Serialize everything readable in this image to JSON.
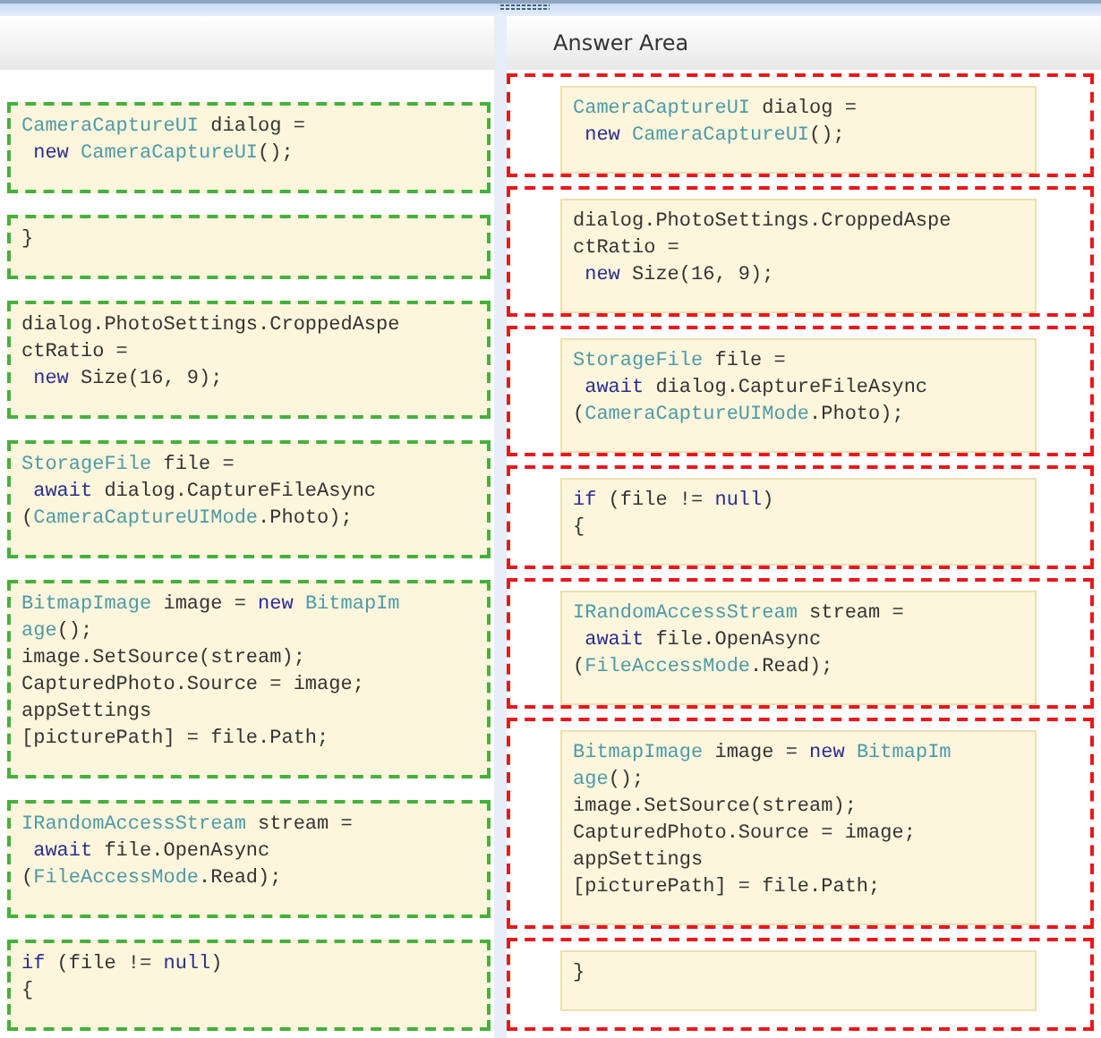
{
  "answer_area": {
    "title": "Answer Area"
  },
  "source_blocks": [
    {
      "lines": [
        [
          {
            "text": "CameraCaptureUI",
            "kind": "type"
          },
          {
            "text": " dialog =",
            "kind": "plain"
          }
        ],
        [
          {
            "text": " new",
            "kind": "keyword"
          },
          {
            "text": " CameraCaptureUI",
            "kind": "type"
          },
          {
            "text": "();",
            "kind": "plain"
          }
        ]
      ]
    },
    {
      "lines": [
        [
          {
            "text": "}",
            "kind": "plain"
          }
        ]
      ]
    },
    {
      "lines": [
        [
          {
            "text": "dialog.PhotoSettings.CroppedAspe",
            "kind": "plain"
          }
        ],
        [
          {
            "text": "ctRatio =",
            "kind": "plain"
          }
        ],
        [
          {
            "text": " new",
            "kind": "keyword"
          },
          {
            "text": " Size(16, 9);",
            "kind": "plain"
          }
        ]
      ]
    },
    {
      "lines": [
        [
          {
            "text": "StorageFile",
            "kind": "type"
          },
          {
            "text": " file =",
            "kind": "plain"
          }
        ],
        [
          {
            "text": " await",
            "kind": "keyword"
          },
          {
            "text": " dialog.CaptureFileAsync",
            "kind": "plain"
          }
        ],
        [
          {
            "text": "(",
            "kind": "plain"
          },
          {
            "text": "CameraCaptureUIMode",
            "kind": "type"
          },
          {
            "text": ".Photo);",
            "kind": "plain"
          }
        ]
      ]
    },
    {
      "lines": [
        [
          {
            "text": "BitmapImage",
            "kind": "type"
          },
          {
            "text": " image = ",
            "kind": "plain"
          },
          {
            "text": "new",
            "kind": "keyword"
          },
          {
            "text": " BitmapIm",
            "kind": "type"
          }
        ],
        [
          {
            "text": "age",
            "kind": "type"
          },
          {
            "text": "();",
            "kind": "plain"
          }
        ],
        [
          {
            "text": "image.SetSource(stream);",
            "kind": "plain"
          }
        ],
        [
          {
            "text": "CapturedPhoto.Source = image;",
            "kind": "plain"
          }
        ],
        [
          {
            "text": "appSettings",
            "kind": "plain"
          }
        ],
        [
          {
            "text": "[picturePath] = file.Path;",
            "kind": "plain"
          }
        ]
      ]
    },
    {
      "lines": [
        [
          {
            "text": "IRandomAccessStream",
            "kind": "type"
          },
          {
            "text": " stream =",
            "kind": "plain"
          }
        ],
        [
          {
            "text": " await",
            "kind": "keyword"
          },
          {
            "text": " file.OpenAsync",
            "kind": "plain"
          }
        ],
        [
          {
            "text": "(",
            "kind": "plain"
          },
          {
            "text": "FileAccessMode",
            "kind": "type"
          },
          {
            "text": ".Read);",
            "kind": "plain"
          }
        ]
      ]
    },
    {
      "lines": [
        [
          {
            "text": "if",
            "kind": "keyword"
          },
          {
            "text": " (file != ",
            "kind": "plain"
          },
          {
            "text": "null",
            "kind": "keyword"
          },
          {
            "text": ")",
            "kind": "plain"
          }
        ],
        [
          {
            "text": "{",
            "kind": "plain"
          }
        ]
      ]
    }
  ],
  "answer_slots": [
    {
      "lines": [
        [
          {
            "text": "CameraCaptureUI",
            "kind": "type"
          },
          {
            "text": " dialog =",
            "kind": "plain"
          }
        ],
        [
          {
            "text": " new",
            "kind": "keyword"
          },
          {
            "text": " CameraCaptureUI",
            "kind": "type"
          },
          {
            "text": "();",
            "kind": "plain"
          }
        ]
      ]
    },
    {
      "lines": [
        [
          {
            "text": "dialog.PhotoSettings.CroppedAspe",
            "kind": "plain"
          }
        ],
        [
          {
            "text": "ctRatio =",
            "kind": "plain"
          }
        ],
        [
          {
            "text": " new",
            "kind": "keyword"
          },
          {
            "text": " Size(16, 9);",
            "kind": "plain"
          }
        ]
      ]
    },
    {
      "lines": [
        [
          {
            "text": "StorageFile",
            "kind": "type"
          },
          {
            "text": " file =",
            "kind": "plain"
          }
        ],
        [
          {
            "text": " await",
            "kind": "keyword"
          },
          {
            "text": " dialog.CaptureFileAsync",
            "kind": "plain"
          }
        ],
        [
          {
            "text": "(",
            "kind": "plain"
          },
          {
            "text": "CameraCaptureUIMode",
            "kind": "type"
          },
          {
            "text": ".Photo);",
            "kind": "plain"
          }
        ]
      ]
    },
    {
      "lines": [
        [
          {
            "text": "if",
            "kind": "keyword"
          },
          {
            "text": " (file != ",
            "kind": "plain"
          },
          {
            "text": "null",
            "kind": "keyword"
          },
          {
            "text": ")",
            "kind": "plain"
          }
        ],
        [
          {
            "text": "{",
            "kind": "plain"
          }
        ]
      ]
    },
    {
      "lines": [
        [
          {
            "text": "IRandomAccessStream",
            "kind": "type"
          },
          {
            "text": " stream =",
            "kind": "plain"
          }
        ],
        [
          {
            "text": " await",
            "kind": "keyword"
          },
          {
            "text": " file.OpenAsync",
            "kind": "plain"
          }
        ],
        [
          {
            "text": "(",
            "kind": "plain"
          },
          {
            "text": "FileAccessMode",
            "kind": "type"
          },
          {
            "text": ".Read);",
            "kind": "plain"
          }
        ]
      ]
    },
    {
      "lines": [
        [
          {
            "text": "BitmapImage",
            "kind": "type"
          },
          {
            "text": " image = ",
            "kind": "plain"
          },
          {
            "text": "new",
            "kind": "keyword"
          },
          {
            "text": " BitmapIm",
            "kind": "type"
          }
        ],
        [
          {
            "text": "age",
            "kind": "type"
          },
          {
            "text": "();",
            "kind": "plain"
          }
        ],
        [
          {
            "text": "image.SetSource(stream);",
            "kind": "plain"
          }
        ],
        [
          {
            "text": "CapturedPhoto.Source = image;",
            "kind": "plain"
          }
        ],
        [
          {
            "text": "appSettings",
            "kind": "plain"
          }
        ],
        [
          {
            "text": "[picturePath] = file.Path;",
            "kind": "plain"
          }
        ]
      ]
    },
    {
      "lines": [
        [
          {
            "text": "}",
            "kind": "plain"
          }
        ]
      ]
    }
  ]
}
